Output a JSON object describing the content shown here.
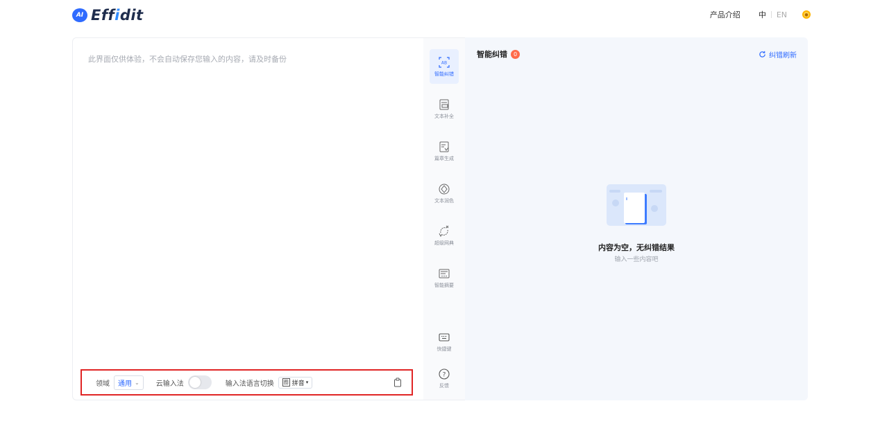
{
  "header": {
    "logo_badge": "AI",
    "logo_pre": "Eff",
    "logo_hl": "i",
    "logo_post": "dit",
    "product_intro": "产品介绍",
    "lang_zh": "中",
    "lang_en": "EN"
  },
  "editor": {
    "placeholder": "此界面仅供体验，不会自动保存您输入的内容，请及时备份",
    "domain_label": "领域",
    "domain_value": "通用",
    "cloud_ime_label": "云输入法",
    "cloud_ime_on": false,
    "ime_lang_label": "输入法语言切换",
    "ime_lang_value": "拼音"
  },
  "toolbar": {
    "items": [
      {
        "label": "智能纠错",
        "icon": "ab-scan-icon",
        "active": true
      },
      {
        "label": "文本补全",
        "icon": "text-complete-icon",
        "active": false
      },
      {
        "label": "篇章生成",
        "icon": "article-generate-icon",
        "active": false
      },
      {
        "label": "文本润色",
        "icon": "polish-icon",
        "active": false
      },
      {
        "label": "超级网典",
        "icon": "dictionary-icon",
        "active": false
      },
      {
        "label": "智能摘要",
        "icon": "summary-icon",
        "active": false
      },
      {
        "label": "快捷键",
        "icon": "keyboard-icon",
        "active": false
      },
      {
        "label": "反馈",
        "icon": "help-icon",
        "active": false
      }
    ]
  },
  "result": {
    "title": "智能纠错",
    "count": "0",
    "refresh_label": "纠错刷新",
    "empty_title": "内容为空，无纠错结果",
    "empty_sub": "输入一些内容吧"
  },
  "colors": {
    "accent": "#2f6bff",
    "badge": "#ff6b4a",
    "highlight_border": "#e02424"
  }
}
